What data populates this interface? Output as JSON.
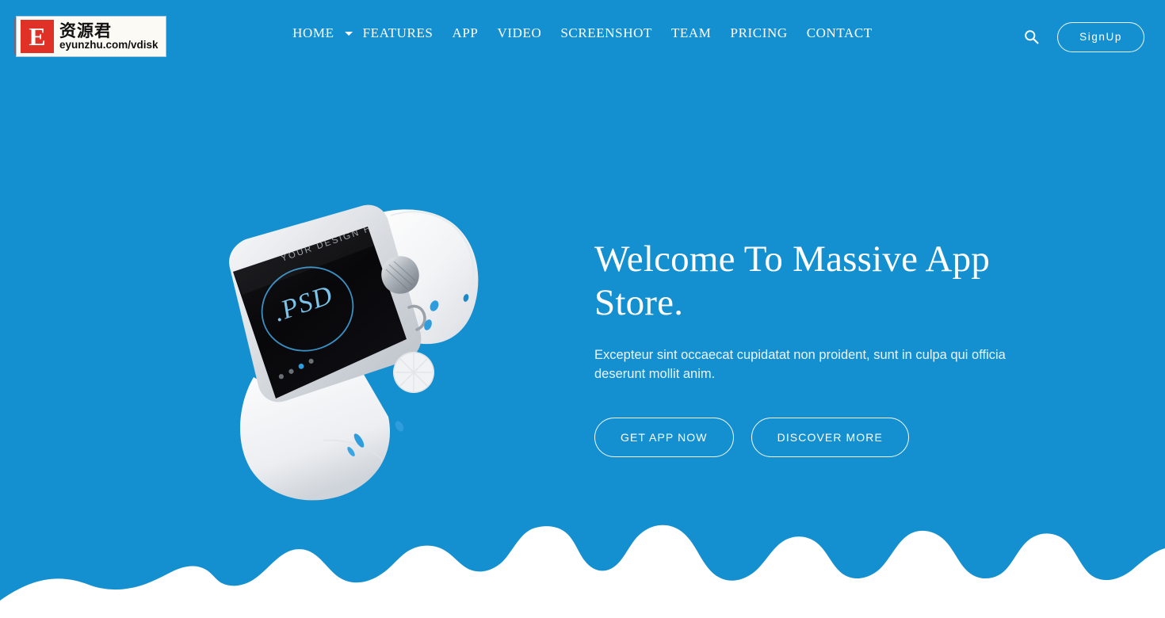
{
  "theme": {
    "background": "#1490d0",
    "accent": "#ffffff",
    "wave": "#ffffff",
    "watermark_red": "#e03127"
  },
  "watermark": {
    "badge_letter": "E",
    "chinese": "资源君",
    "url": "eyunzhu.com/vdisk"
  },
  "header": {
    "nav": [
      {
        "label": "HOME",
        "active": true,
        "has_caret": true
      },
      {
        "label": "FEATURES",
        "active": false,
        "has_caret": false
      },
      {
        "label": "APP",
        "active": false,
        "has_caret": false
      },
      {
        "label": "VIDEO",
        "active": false,
        "has_caret": false
      },
      {
        "label": "SCREENSHOT",
        "active": false,
        "has_caret": false
      },
      {
        "label": "TEAM",
        "active": false,
        "has_caret": false
      },
      {
        "label": "PRICING",
        "active": false,
        "has_caret": false
      },
      {
        "label": "CONTACT",
        "active": false,
        "has_caret": false
      }
    ],
    "search_icon": "search-icon",
    "signup_label": "SignUp"
  },
  "hero": {
    "title": "Welcome To Massive App Store.",
    "subtitle": "Excepteur sint occaecat cupidatat non proident, sunt in culpa qui officia deserunt mollit anim.",
    "primary_button": "GET APP NOW",
    "secondary_button": "DISCOVER MORE"
  },
  "watch": {
    "screen_top_text": "YOUR DESIGN HERE",
    "screen_center_text": ".PSD",
    "dots_count": 4,
    "active_dot_index": 2,
    "screen_color": "#0a0a0c",
    "accent_color": "#35a8e8",
    "band_color": "#f4f5f7"
  }
}
